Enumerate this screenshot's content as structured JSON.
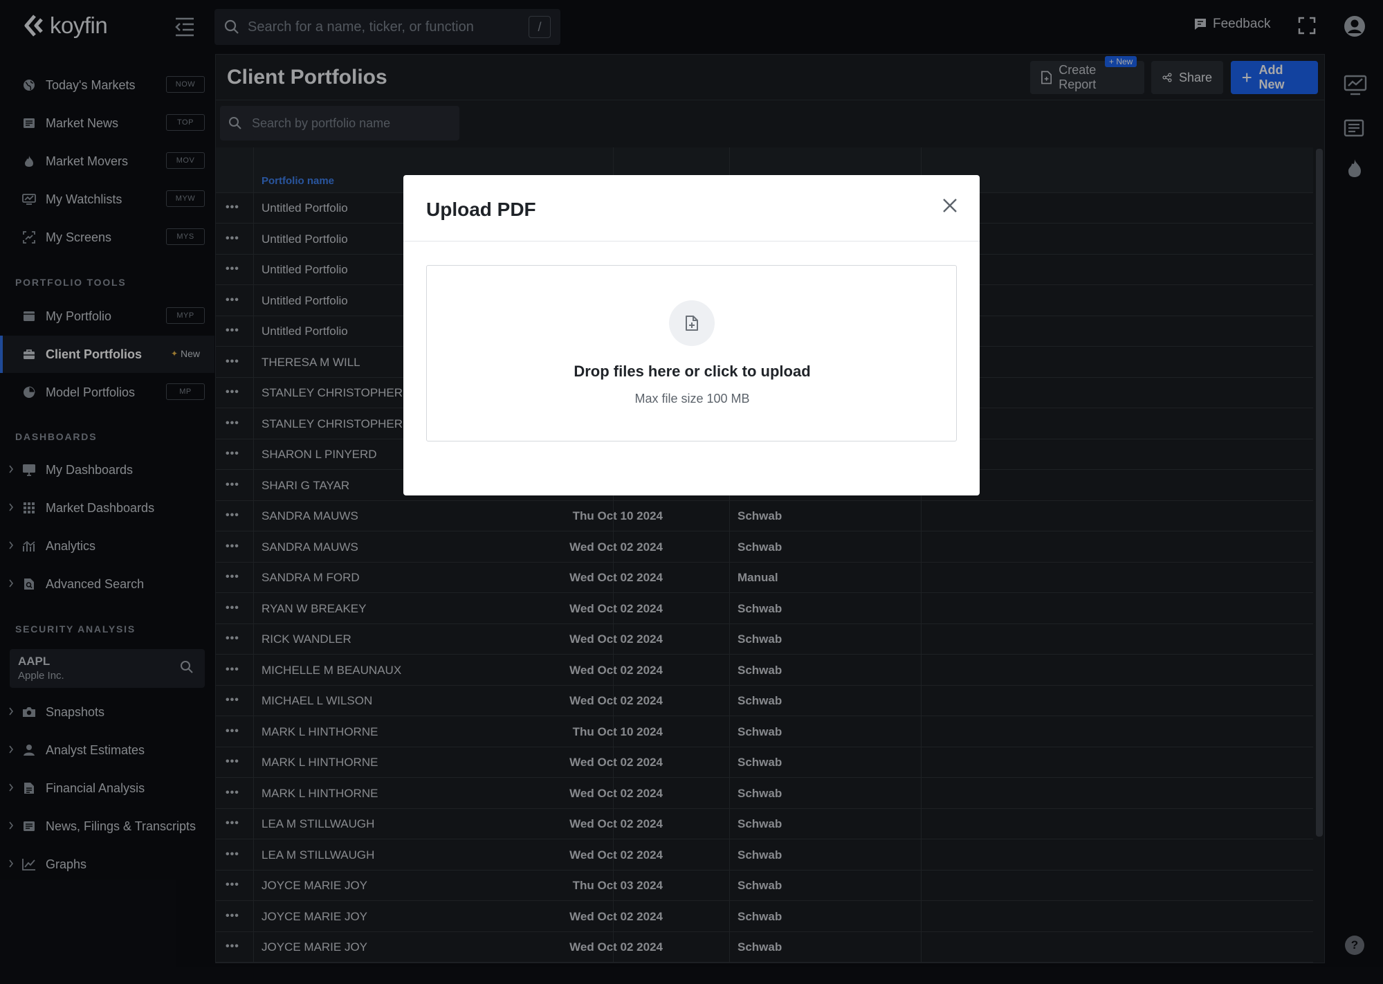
{
  "app": {
    "logo_text": "koyfin"
  },
  "header": {
    "search_placeholder": "Search for a name, ticker, or function",
    "search_shortcut": "/",
    "feedback_label": "Feedback"
  },
  "sidebar": {
    "top_items": [
      {
        "label": "Today's Markets",
        "badge": "NOW"
      },
      {
        "label": "Market News",
        "badge": "TOP"
      },
      {
        "label": "Market Movers",
        "badge": "MOV"
      },
      {
        "label": "My Watchlists",
        "badge": "MYW"
      },
      {
        "label": "My Screens",
        "badge": "MYS"
      }
    ],
    "portfolio_tools_heading": "PORTFOLIO TOOLS",
    "portfolio_items": [
      {
        "label": "My Portfolio",
        "badge": "MYP"
      },
      {
        "label": "Client Portfolios",
        "badge": "New"
      },
      {
        "label": "Model Portfolios",
        "badge": "MP"
      }
    ],
    "dashboards_heading": "DASHBOARDS",
    "dashboard_items": [
      {
        "label": "My Dashboards"
      },
      {
        "label": "Market Dashboards"
      },
      {
        "label": "Analytics"
      },
      {
        "label": "Advanced Search"
      }
    ],
    "security_heading": "SECURITY ANALYSIS",
    "security": {
      "ticker": "AAPL",
      "company": "Apple Inc."
    },
    "security_items": [
      {
        "label": "Snapshots"
      },
      {
        "label": "Analyst Estimates"
      },
      {
        "label": "Financial Analysis"
      },
      {
        "label": "News, Filings & Transcripts"
      },
      {
        "label": "Graphs"
      }
    ]
  },
  "main": {
    "title": "Client Portfolios",
    "create_report_label": "Create Report",
    "new_tag": "+ New",
    "share_label": "Share",
    "add_new_label": "Add New",
    "search_placeholder": "Search by portfolio name",
    "column_portfolio_name": "Portfolio name",
    "rows": [
      {
        "name": "Untitled Portfolio",
        "date": "",
        "source": ""
      },
      {
        "name": "Untitled Portfolio",
        "date": "",
        "source": ""
      },
      {
        "name": "Untitled Portfolio",
        "date": "",
        "source": ""
      },
      {
        "name": "Untitled Portfolio",
        "date": "",
        "source": ""
      },
      {
        "name": "Untitled Portfolio",
        "date": "",
        "source": ""
      },
      {
        "name": "THERESA M WILL",
        "date": "",
        "source": ""
      },
      {
        "name": "STANLEY CHRISTOPHERSON",
        "date": "",
        "source": ""
      },
      {
        "name": "STANLEY CHRISTOPHERSON",
        "date": "",
        "source": ""
      },
      {
        "name": "SHARON L PINYERD",
        "date": "",
        "source": ""
      },
      {
        "name": "SHARI G TAYAR",
        "date": "",
        "source": ""
      },
      {
        "name": "SANDRA MAUWS",
        "date": "Thu Oct 10 2024",
        "source": "Schwab"
      },
      {
        "name": "SANDRA MAUWS",
        "date": "Wed Oct 02 2024",
        "source": "Schwab"
      },
      {
        "name": "SANDRA M FORD",
        "date": "Wed Oct 02 2024",
        "source": "Manual"
      },
      {
        "name": "RYAN W BREAKEY",
        "date": "Wed Oct 02 2024",
        "source": "Schwab"
      },
      {
        "name": "RICK WANDLER",
        "date": "Wed Oct 02 2024",
        "source": "Schwab"
      },
      {
        "name": "MICHELLE M BEAUNAUX",
        "date": "Wed Oct 02 2024",
        "source": "Schwab"
      },
      {
        "name": "MICHAEL L WILSON",
        "date": "Wed Oct 02 2024",
        "source": "Schwab"
      },
      {
        "name": "MARK L HINTHORNE",
        "date": "Thu Oct 10 2024",
        "source": "Schwab"
      },
      {
        "name": "MARK L HINTHORNE",
        "date": "Wed Oct 02 2024",
        "source": "Schwab"
      },
      {
        "name": "MARK L HINTHORNE",
        "date": "Wed Oct 02 2024",
        "source": "Schwab"
      },
      {
        "name": "LEA M STILLWAUGH",
        "date": "Wed Oct 02 2024",
        "source": "Schwab"
      },
      {
        "name": "LEA M STILLWAUGH",
        "date": "Wed Oct 02 2024",
        "source": "Schwab"
      },
      {
        "name": "JOYCE MARIE JOY",
        "date": "Thu Oct 03 2024",
        "source": "Schwab"
      },
      {
        "name": "JOYCE MARIE JOY",
        "date": "Wed Oct 02 2024",
        "source": "Schwab"
      },
      {
        "name": "JOYCE MARIE JOY",
        "date": "Wed Oct 02 2024",
        "source": "Schwab"
      }
    ]
  },
  "modal": {
    "title": "Upload PDF",
    "drop_title": "Drop files here or click to upload",
    "drop_subtitle": "Max file size 100 MB"
  },
  "help": {
    "label": "?"
  },
  "icons": {
    "collapse": "collapse-sidebar-icon",
    "search": "search-icon",
    "feedback": "feedback-icon",
    "fullscreen": "fullscreen-icon",
    "account": "account-icon",
    "close": "close-icon",
    "file_add": "file-add-icon"
  },
  "colors": {
    "accent": "#1c64f2",
    "link": "#3f82f0",
    "background": "#0d0f13",
    "panel": "#1a1d22"
  }
}
